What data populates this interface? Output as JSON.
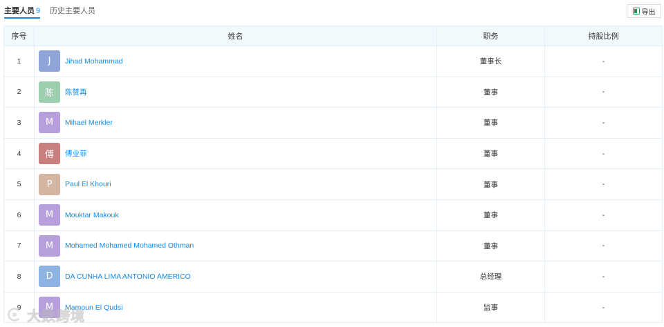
{
  "tabs": {
    "main_label": "主要人员",
    "main_count": "9",
    "history_label": "历史主要人员"
  },
  "export_label": "导出",
  "columns": {
    "index": "序号",
    "name": "姓名",
    "role": "职务",
    "share": "持股比例"
  },
  "rows": [
    {
      "idx": "1",
      "avatar": "J",
      "avatar_color": "#8fa5d8",
      "name": "Jihad Mohammad",
      "role": "董事长",
      "share": "-"
    },
    {
      "idx": "2",
      "avatar": "陈",
      "avatar_color": "#9ccfae",
      "name": "陈赞再",
      "role": "董事",
      "share": "-"
    },
    {
      "idx": "3",
      "avatar": "M",
      "avatar_color": "#b79fdc",
      "name": "Mihael Merkler",
      "role": "董事",
      "share": "-"
    },
    {
      "idx": "4",
      "avatar": "傅",
      "avatar_color": "#c87f7e",
      "name": "傅业菲",
      "role": "董事",
      "share": "-"
    },
    {
      "idx": "5",
      "avatar": "P",
      "avatar_color": "#d3b5a2",
      "name": "Paul El Khouri",
      "role": "董事",
      "share": "-"
    },
    {
      "idx": "6",
      "avatar": "M",
      "avatar_color": "#b79fdc",
      "name": "Mouktar Makouk",
      "role": "董事",
      "share": "-"
    },
    {
      "idx": "7",
      "avatar": "M",
      "avatar_color": "#b79fdc",
      "name": "Mohamed Mohamed Mohamed Othman",
      "role": "董事",
      "share": "-"
    },
    {
      "idx": "8",
      "avatar": "D",
      "avatar_color": "#8db3e2",
      "name": "DA CUNHA LIMA ANTONIO AMERICO",
      "role": "总经理",
      "share": "-"
    },
    {
      "idx": "9",
      "avatar": "M",
      "avatar_color": "#b79fdc",
      "name": "Mamoun El Qudsi",
      "role": "监事",
      "share": "-"
    }
  ],
  "watermark": "大数跨境",
  "icons": {
    "export": "excel-icon",
    "watermark_logo": "watermark-logo-icon"
  }
}
